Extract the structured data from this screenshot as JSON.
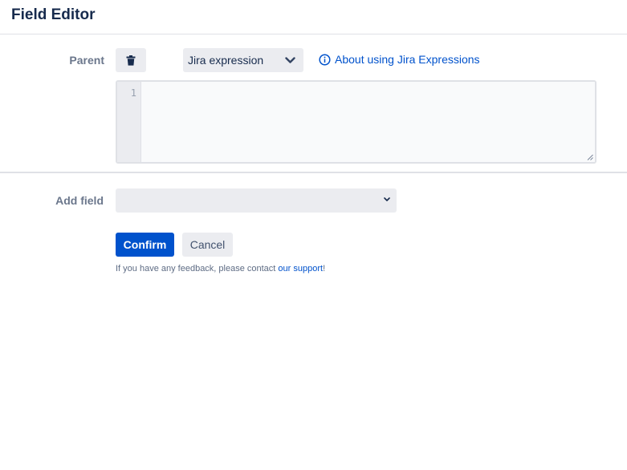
{
  "header": {
    "title": "Field Editor"
  },
  "parent_row": {
    "label": "Parent",
    "delete_icon": "trash-icon",
    "mode_select": {
      "value": "Jira expression",
      "icon": "chevron-down-icon"
    },
    "help_link": {
      "icon": "info-circle-icon",
      "text": "About using Jira Expressions"
    },
    "editor": {
      "line_numbers": [
        "1"
      ],
      "code": ""
    }
  },
  "add_field_row": {
    "label": "Add field",
    "select_value": "",
    "icon": "chevron-down-icon"
  },
  "actions": {
    "confirm_label": "Confirm",
    "cancel_label": "Cancel"
  },
  "feedback": {
    "prefix": "If you have any feedback, please contact ",
    "link_text": "our support",
    "suffix": "!"
  },
  "colors": {
    "primary": "#0052cc",
    "text": "#172b4d",
    "subtle_text": "#6b778c",
    "neutral_bg": "#ebecf0",
    "border": "#dfe1e6"
  }
}
